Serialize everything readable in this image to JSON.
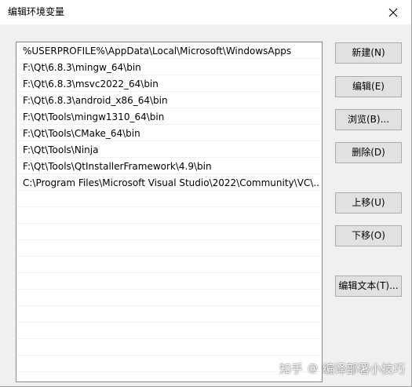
{
  "window": {
    "title": "编辑环境变量",
    "close_glyph": "✕"
  },
  "paths": [
    "%USERPROFILE%\\AppData\\Local\\Microsoft\\WindowsApps",
    "F:\\Qt\\6.8.3\\mingw_64\\bin",
    "F:\\Qt\\6.8.3\\msvc2022_64\\bin",
    "F:\\Qt\\6.8.3\\android_x86_64\\bin",
    "F:\\Qt\\Tools\\mingw1310_64\\bin",
    "F:\\Qt\\Tools\\CMake_64\\bin",
    "F:\\Qt\\Tools\\Ninja",
    "F:\\Qt\\Tools\\QtInstallerFramework\\4.9\\bin",
    "C:\\Program Files\\Microsoft Visual Studio\\2022\\Community\\VC\\..."
  ],
  "buttons": {
    "new": "新建(N)",
    "edit": "编辑(E)",
    "browse": "浏览(B)...",
    "delete": "删除(D)",
    "move_up": "上移(U)",
    "move_down": "下移(O)",
    "edit_text": "编辑文本(T)..."
  },
  "watermark": {
    "site": "知乎",
    "separator": "@",
    "author": "编译部署小技巧"
  },
  "colors": {
    "window_bg": "#f0f0f0",
    "button_bg": "#e1e1e1",
    "button_border": "#adadad",
    "list_border": "#828790"
  }
}
